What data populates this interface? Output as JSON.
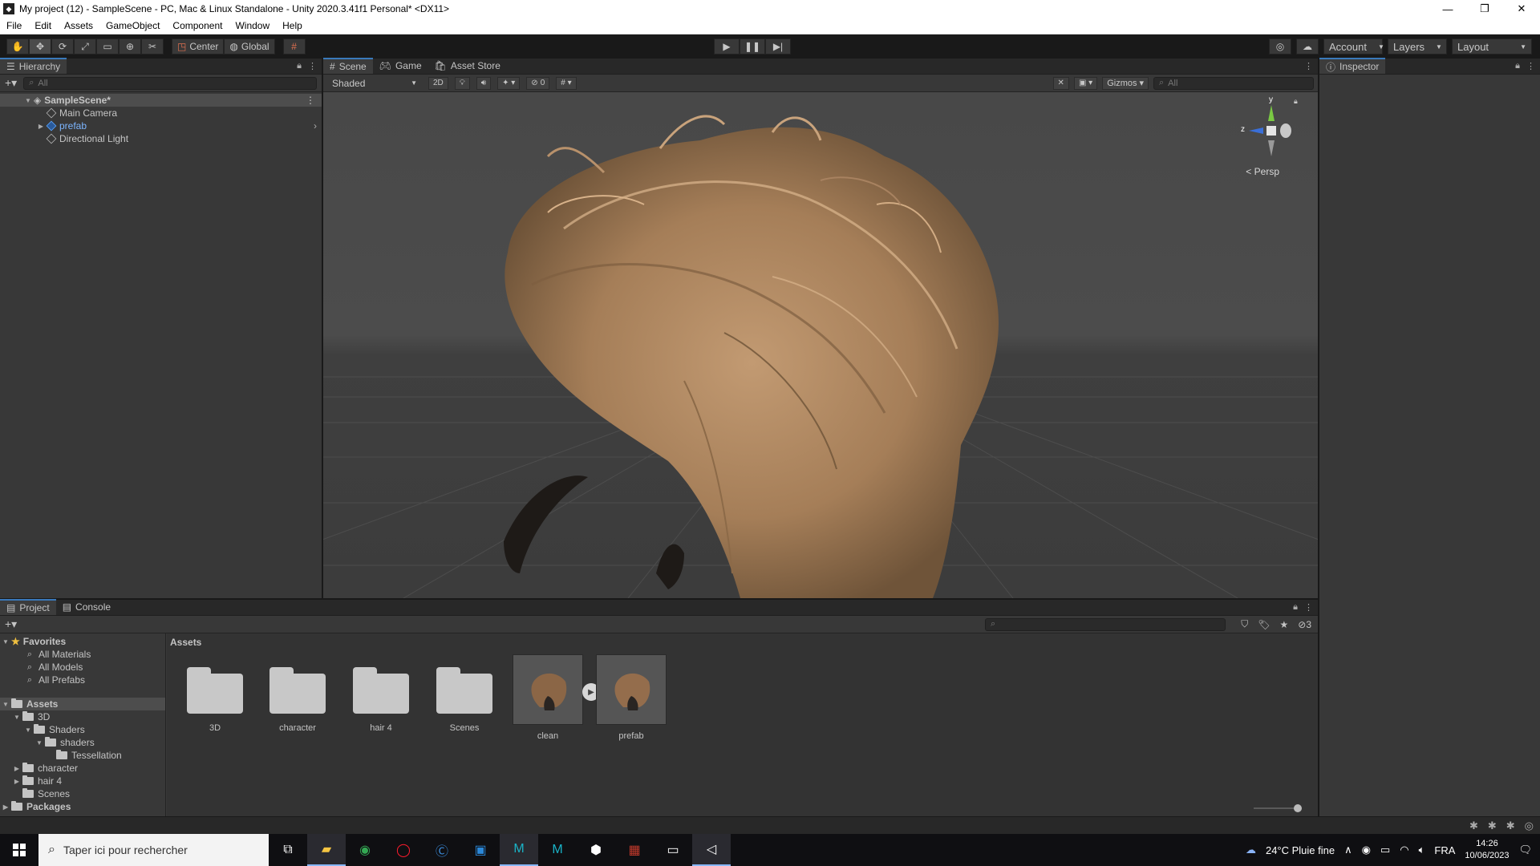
{
  "window": {
    "title": "My project (12) - SampleScene - PC, Mac & Linux Standalone - Unity 2020.3.41f1 Personal* <DX11>"
  },
  "menu": [
    "File",
    "Edit",
    "Assets",
    "GameObject",
    "Component",
    "Window",
    "Help"
  ],
  "toolbar": {
    "pivot_label": "Center",
    "space_label": "Global",
    "account_label": "Account",
    "layers_label": "Layers",
    "layout_label": "Layout"
  },
  "hierarchy": {
    "tab_label": "Hierarchy",
    "search_placeholder": "All",
    "scene_name": "SampleScene*",
    "items": [
      {
        "label": "Main Camera"
      },
      {
        "label": "prefab"
      },
      {
        "label": "Directional Light"
      }
    ]
  },
  "scene": {
    "tabs": [
      "Scene",
      "Game",
      "Asset Store"
    ],
    "shading_mode": "Shaded",
    "mode_2d": "2D",
    "hidden_count": "0",
    "gizmos_label": "Gizmos",
    "search_placeholder": "All",
    "persp_label": "Persp",
    "axis_y": "y",
    "axis_z": "z"
  },
  "inspector": {
    "tab_label": "Inspector"
  },
  "project": {
    "tabs": [
      "Project",
      "Console"
    ],
    "breadcrumb": "Assets",
    "hidden_packages_count": "3",
    "favorites": {
      "label": "Favorites",
      "items": [
        "All Materials",
        "All Models",
        "All Prefabs"
      ]
    },
    "tree": {
      "root": "Assets",
      "items": [
        {
          "label": "3D"
        },
        {
          "label": "Shaders"
        },
        {
          "label": "shaders"
        },
        {
          "label": "Tessellation"
        },
        {
          "label": "character"
        },
        {
          "label": "hair 4"
        },
        {
          "label": "Scenes"
        }
      ],
      "packages": "Packages"
    },
    "assets": [
      {
        "label": "3D",
        "kind": "folder"
      },
      {
        "label": "character",
        "kind": "folder"
      },
      {
        "label": "hair 4",
        "kind": "folder"
      },
      {
        "label": "Scenes",
        "kind": "folder"
      },
      {
        "label": "clean",
        "kind": "model"
      },
      {
        "label": "prefab",
        "kind": "prefab"
      }
    ]
  },
  "taskbar": {
    "search_placeholder": "Taper ici pour rechercher",
    "weather": "24°C Pluie fine",
    "language": "FRA",
    "time": "14:26",
    "date": "10/06/2023"
  },
  "colors": {
    "accent": "#3a79bb",
    "hair": "#b08a66",
    "editor_bg": "#383838"
  }
}
